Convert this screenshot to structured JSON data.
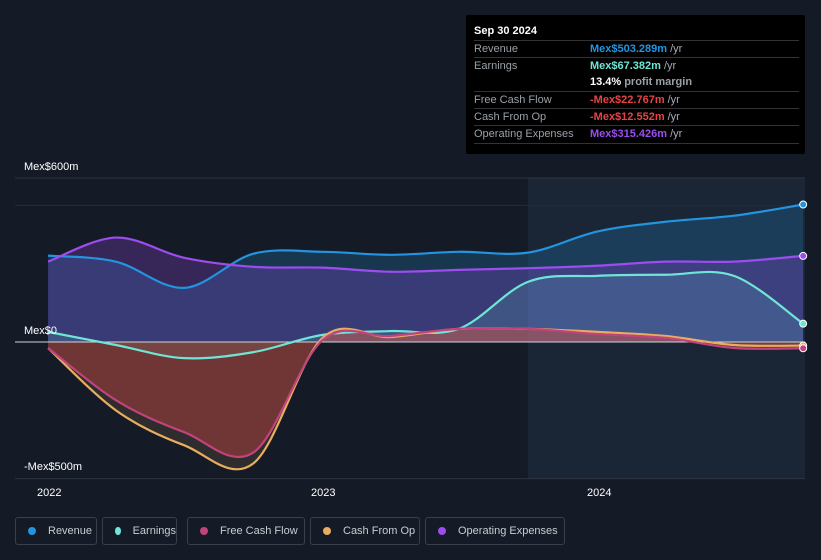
{
  "tooltip": {
    "date": "Sep 30 2024",
    "rows": [
      {
        "label": "Revenue",
        "value": "Mex$503.289m",
        "unit": "/yr",
        "color": "#2394df"
      },
      {
        "label": "Earnings",
        "value": "Mex$67.382m",
        "unit": "/yr",
        "color": "#6ee6d6"
      },
      {
        "label": "",
        "value": "13.4%",
        "unit": "profit margin",
        "color": "#ffffff"
      },
      {
        "label": "Free Cash Flow",
        "value": "-Mex$22.767m",
        "unit": "/yr",
        "color": "#e64444"
      },
      {
        "label": "Cash From Op",
        "value": "-Mex$12.552m",
        "unit": "/yr",
        "color": "#e64444"
      },
      {
        "label": "Operating Expenses",
        "value": "Mex$315.426m",
        "unit": "/yr",
        "color": "#9d4cf0"
      }
    ]
  },
  "chart_data": {
    "type": "area",
    "x": [
      "2021-12-31",
      "2022-03-31",
      "2022-06-30",
      "2022-09-30",
      "2022-12-31",
      "2023-03-31",
      "2023-06-30",
      "2023-09-30",
      "2023-12-31",
      "2024-03-31",
      "2024-06-30",
      "2024-09-30"
    ],
    "series": [
      {
        "name": "Revenue",
        "color": "#2394df",
        "values": [
          316,
          294,
          198,
          323,
          330,
          319,
          330,
          327,
          404,
          440,
          462,
          503
        ]
      },
      {
        "name": "Earnings",
        "color": "#6ee6d6",
        "values": [
          37,
          -11,
          -59,
          -37,
          26,
          40,
          48,
          220,
          242,
          246,
          242,
          67
        ]
      },
      {
        "name": "Free Cash Flow",
        "color": "#c2437c",
        "values": [
          -22,
          -213,
          -330,
          -404,
          7,
          22,
          48,
          48,
          29,
          15,
          -22,
          -23
        ]
      },
      {
        "name": "Cash From Op",
        "color": "#e8ad5e",
        "values": [
          -22,
          -250,
          -378,
          -444,
          15,
          18,
          48,
          48,
          37,
          22,
          -11,
          -13
        ]
      },
      {
        "name": "Operating Expenses",
        "color": "#9d4cf0",
        "values": [
          294,
          382,
          308,
          275,
          272,
          257,
          264,
          270,
          279,
          294,
          294,
          315
        ]
      }
    ],
    "y_tick_labels": [
      "Mex$600m",
      "Mex$0",
      "-Mex$500m"
    ],
    "y_ticks": [
      600,
      0,
      -500
    ],
    "x_tick_labels": [
      "2022",
      "2023",
      "2024"
    ],
    "ylim": [
      -500,
      600
    ],
    "legend": "bottom",
    "highlight_from": "2023-09-30"
  }
}
